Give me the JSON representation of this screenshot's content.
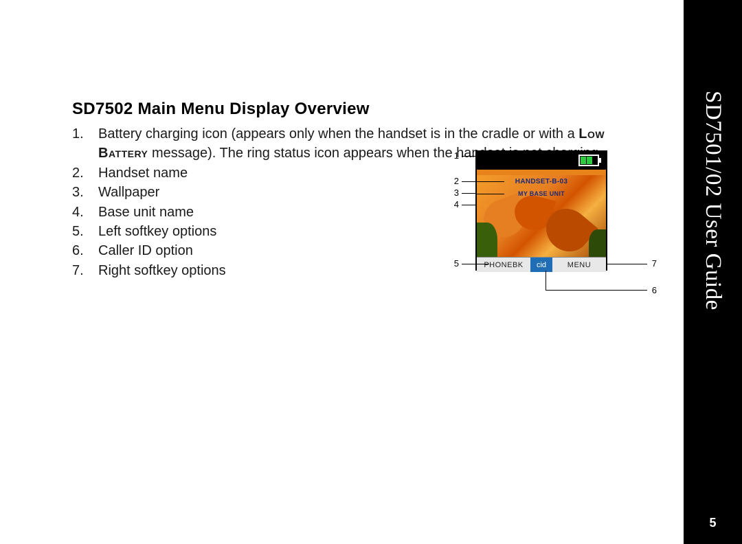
{
  "sidebar": {
    "title": "SD7501/02 User Guide",
    "page_number": "5"
  },
  "heading": "SD7502 Main Menu Display Overview",
  "items": {
    "i1_part1": "Battery charging icon (appears only when the handset is in the cradle or with a",
    "i1_low_battery": "Low Battery",
    "i1_part2": " message). The ring status icon appears when the handset is not charging.",
    "i2": "Handset name",
    "i3": "Wallpaper",
    "i4": "Base unit name",
    "i5": "Left softkey options",
    "i6": "Caller ID option",
    "i7": "Right softkey options"
  },
  "diagram": {
    "handset_label": "HANDSET-B-03",
    "base_label": "MY BASE UNIT",
    "sk_left": "PHONEBK",
    "sk_cid": "cid",
    "sk_right": "MENU",
    "callouts": {
      "c1": "1",
      "c2": "2",
      "c3": "3",
      "c4": "4",
      "c5": "5",
      "c6": "6",
      "c7": "7"
    }
  }
}
